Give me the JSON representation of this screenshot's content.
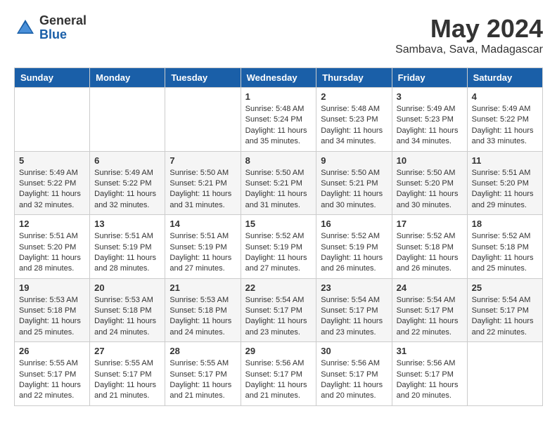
{
  "header": {
    "logo_general": "General",
    "logo_blue": "Blue",
    "month": "May 2024",
    "location": "Sambava, Sava, Madagascar"
  },
  "weekdays": [
    "Sunday",
    "Monday",
    "Tuesday",
    "Wednesday",
    "Thursday",
    "Friday",
    "Saturday"
  ],
  "weeks": [
    [
      {
        "day": "",
        "info": ""
      },
      {
        "day": "",
        "info": ""
      },
      {
        "day": "",
        "info": ""
      },
      {
        "day": "1",
        "info": "Sunrise: 5:48 AM\nSunset: 5:24 PM\nDaylight: 11 hours\nand 35 minutes."
      },
      {
        "day": "2",
        "info": "Sunrise: 5:48 AM\nSunset: 5:23 PM\nDaylight: 11 hours\nand 34 minutes."
      },
      {
        "day": "3",
        "info": "Sunrise: 5:49 AM\nSunset: 5:23 PM\nDaylight: 11 hours\nand 34 minutes."
      },
      {
        "day": "4",
        "info": "Sunrise: 5:49 AM\nSunset: 5:22 PM\nDaylight: 11 hours\nand 33 minutes."
      }
    ],
    [
      {
        "day": "5",
        "info": "Sunrise: 5:49 AM\nSunset: 5:22 PM\nDaylight: 11 hours\nand 32 minutes."
      },
      {
        "day": "6",
        "info": "Sunrise: 5:49 AM\nSunset: 5:22 PM\nDaylight: 11 hours\nand 32 minutes."
      },
      {
        "day": "7",
        "info": "Sunrise: 5:50 AM\nSunset: 5:21 PM\nDaylight: 11 hours\nand 31 minutes."
      },
      {
        "day": "8",
        "info": "Sunrise: 5:50 AM\nSunset: 5:21 PM\nDaylight: 11 hours\nand 31 minutes."
      },
      {
        "day": "9",
        "info": "Sunrise: 5:50 AM\nSunset: 5:21 PM\nDaylight: 11 hours\nand 30 minutes."
      },
      {
        "day": "10",
        "info": "Sunrise: 5:50 AM\nSunset: 5:20 PM\nDaylight: 11 hours\nand 30 minutes."
      },
      {
        "day": "11",
        "info": "Sunrise: 5:51 AM\nSunset: 5:20 PM\nDaylight: 11 hours\nand 29 minutes."
      }
    ],
    [
      {
        "day": "12",
        "info": "Sunrise: 5:51 AM\nSunset: 5:20 PM\nDaylight: 11 hours\nand 28 minutes."
      },
      {
        "day": "13",
        "info": "Sunrise: 5:51 AM\nSunset: 5:19 PM\nDaylight: 11 hours\nand 28 minutes."
      },
      {
        "day": "14",
        "info": "Sunrise: 5:51 AM\nSunset: 5:19 PM\nDaylight: 11 hours\nand 27 minutes."
      },
      {
        "day": "15",
        "info": "Sunrise: 5:52 AM\nSunset: 5:19 PM\nDaylight: 11 hours\nand 27 minutes."
      },
      {
        "day": "16",
        "info": "Sunrise: 5:52 AM\nSunset: 5:19 PM\nDaylight: 11 hours\nand 26 minutes."
      },
      {
        "day": "17",
        "info": "Sunrise: 5:52 AM\nSunset: 5:18 PM\nDaylight: 11 hours\nand 26 minutes."
      },
      {
        "day": "18",
        "info": "Sunrise: 5:52 AM\nSunset: 5:18 PM\nDaylight: 11 hours\nand 25 minutes."
      }
    ],
    [
      {
        "day": "19",
        "info": "Sunrise: 5:53 AM\nSunset: 5:18 PM\nDaylight: 11 hours\nand 25 minutes."
      },
      {
        "day": "20",
        "info": "Sunrise: 5:53 AM\nSunset: 5:18 PM\nDaylight: 11 hours\nand 24 minutes."
      },
      {
        "day": "21",
        "info": "Sunrise: 5:53 AM\nSunset: 5:18 PM\nDaylight: 11 hours\nand 24 minutes."
      },
      {
        "day": "22",
        "info": "Sunrise: 5:54 AM\nSunset: 5:17 PM\nDaylight: 11 hours\nand 23 minutes."
      },
      {
        "day": "23",
        "info": "Sunrise: 5:54 AM\nSunset: 5:17 PM\nDaylight: 11 hours\nand 23 minutes."
      },
      {
        "day": "24",
        "info": "Sunrise: 5:54 AM\nSunset: 5:17 PM\nDaylight: 11 hours\nand 22 minutes."
      },
      {
        "day": "25",
        "info": "Sunrise: 5:54 AM\nSunset: 5:17 PM\nDaylight: 11 hours\nand 22 minutes."
      }
    ],
    [
      {
        "day": "26",
        "info": "Sunrise: 5:55 AM\nSunset: 5:17 PM\nDaylight: 11 hours\nand 22 minutes."
      },
      {
        "day": "27",
        "info": "Sunrise: 5:55 AM\nSunset: 5:17 PM\nDaylight: 11 hours\nand 21 minutes."
      },
      {
        "day": "28",
        "info": "Sunrise: 5:55 AM\nSunset: 5:17 PM\nDaylight: 11 hours\nand 21 minutes."
      },
      {
        "day": "29",
        "info": "Sunrise: 5:56 AM\nSunset: 5:17 PM\nDaylight: 11 hours\nand 21 minutes."
      },
      {
        "day": "30",
        "info": "Sunrise: 5:56 AM\nSunset: 5:17 PM\nDaylight: 11 hours\nand 20 minutes."
      },
      {
        "day": "31",
        "info": "Sunrise: 5:56 AM\nSunset: 5:17 PM\nDaylight: 11 hours\nand 20 minutes."
      },
      {
        "day": "",
        "info": ""
      }
    ]
  ]
}
